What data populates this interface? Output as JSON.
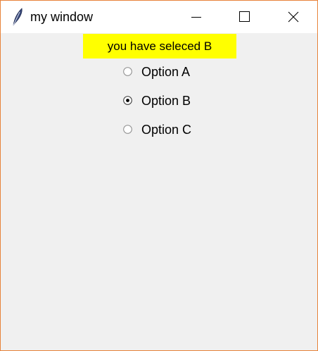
{
  "window": {
    "title": "my window",
    "icon": "feather-icon",
    "controls": [
      "minimize-icon",
      "maximize-icon",
      "close-icon"
    ]
  },
  "status_label": {
    "text": "you have seleced B",
    "background": "#ffff00"
  },
  "radio_group": {
    "selected": "Option B",
    "options": [
      {
        "label": "Option A",
        "checked": false
      },
      {
        "label": "Option B",
        "checked": true
      },
      {
        "label": "Option C",
        "checked": false
      }
    ]
  },
  "colors": {
    "window_border": "#e8833a",
    "client_background": "#f0f0f0",
    "titlebar_background": "#ffffff"
  }
}
